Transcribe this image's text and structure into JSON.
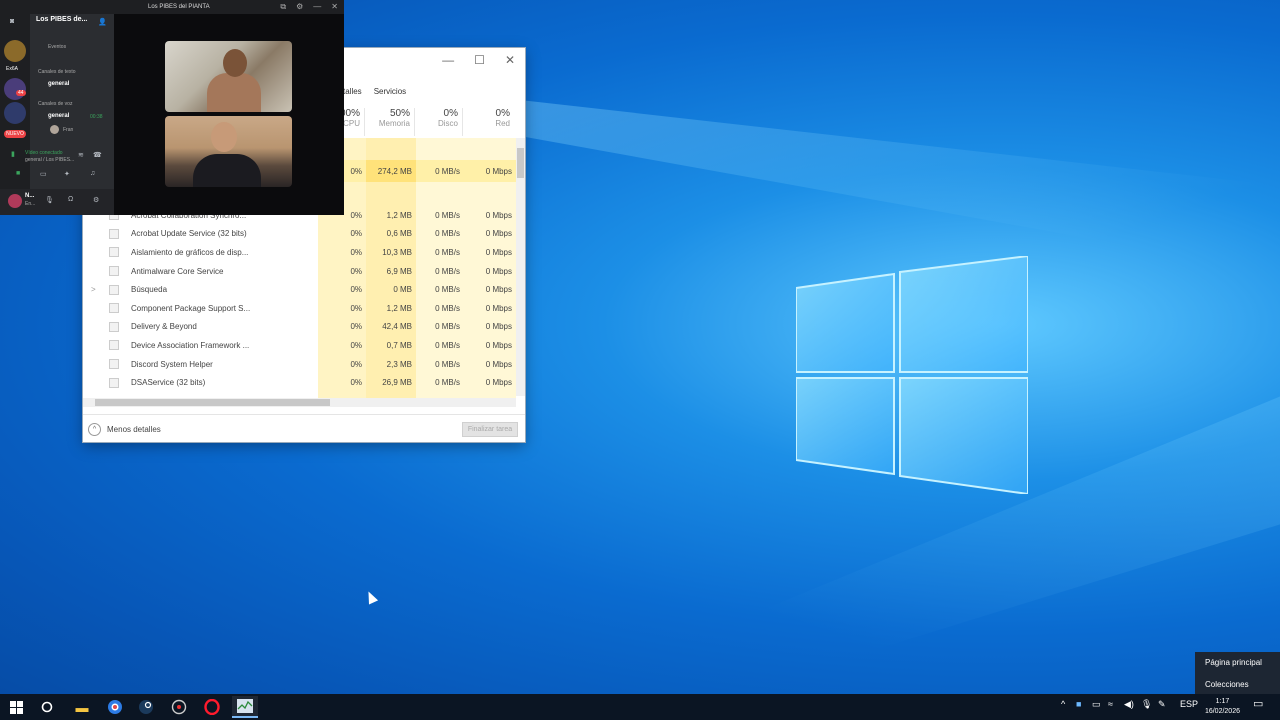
{
  "discord": {
    "window_title": "Los PIBES del PIANTA",
    "server_name": "Los PIBES de...",
    "events": "Eventos",
    "text_category": "Canales de texto",
    "text_channel": "general",
    "voice_category": "Canales de voz",
    "voice_channel": "general",
    "voice_time": "00:38",
    "voice_member": "Fran",
    "guild_label": "Ex6A",
    "badge_count": "44",
    "live_badge": "NUEVO",
    "voice_status": "Vídeo conectado",
    "voice_location": "general / Los PIBES...",
    "user_name": "N...",
    "user_status": "En..."
  },
  "taskmanager": {
    "tabs": [
      "talles",
      "Servicios"
    ],
    "columns": [
      {
        "pct": "00%",
        "label": "CPU"
      },
      {
        "pct": "50%",
        "label": "Memoria"
      },
      {
        "pct": "0%",
        "label": "Disco"
      },
      {
        "pct": "0%",
        "label": "Red"
      }
    ],
    "highlight_row": {
      "cpu": "0%",
      "mem": "274,2 MB",
      "disk": "0 MB/s",
      "net": "0 Mbps"
    },
    "rows": [
      {
        "name": "Acrobat Collaboration Synchro...",
        "cpu": "0%",
        "mem": "1,2 MB",
        "disk": "0 MB/s",
        "net": "0 Mbps",
        "expand": ""
      },
      {
        "name": "Acrobat Update Service (32 bits)",
        "cpu": "0%",
        "mem": "0,6 MB",
        "disk": "0 MB/s",
        "net": "0 Mbps",
        "expand": ""
      },
      {
        "name": "Aislamiento de gráficos de disp...",
        "cpu": "0%",
        "mem": "10,3 MB",
        "disk": "0 MB/s",
        "net": "0 Mbps",
        "expand": ""
      },
      {
        "name": "Antimalware Core Service",
        "cpu": "0%",
        "mem": "6,9 MB",
        "disk": "0 MB/s",
        "net": "0 Mbps",
        "expand": ""
      },
      {
        "name": "Búsqueda",
        "cpu": "0%",
        "mem": "0 MB",
        "disk": "0 MB/s",
        "net": "0 Mbps",
        "expand": ">"
      },
      {
        "name": "Component Package Support S...",
        "cpu": "0%",
        "mem": "1,2 MB",
        "disk": "0 MB/s",
        "net": "0 Mbps",
        "expand": ""
      },
      {
        "name": "Delivery & Beyond",
        "cpu": "0%",
        "mem": "42,4 MB",
        "disk": "0 MB/s",
        "net": "0 Mbps",
        "expand": ""
      },
      {
        "name": "Device Association Framework ...",
        "cpu": "0%",
        "mem": "0,7 MB",
        "disk": "0 MB/s",
        "net": "0 Mbps",
        "expand": ""
      },
      {
        "name": "Discord System Helper",
        "cpu": "0%",
        "mem": "2,3 MB",
        "disk": "0 MB/s",
        "net": "0 Mbps",
        "expand": ""
      },
      {
        "name": "DSAService (32 bits)",
        "cpu": "0%",
        "mem": "26,9 MB",
        "disk": "0 MB/s",
        "net": "0 Mbps",
        "expand": ""
      }
    ],
    "less_details": "Menos detalles",
    "end_task": "Finalizar tarea"
  },
  "taskbar": {
    "language": "ESP",
    "time": "1:17",
    "date": "16/02/2026"
  },
  "popup": {
    "items": [
      "Página principal",
      "Colecciones"
    ]
  },
  "colors": {
    "desktop_blue": "#0a6bd0",
    "taskbar": "#0b1523",
    "discord_bg": "#1e1f22",
    "memory_highlight": "#ffe27a"
  }
}
